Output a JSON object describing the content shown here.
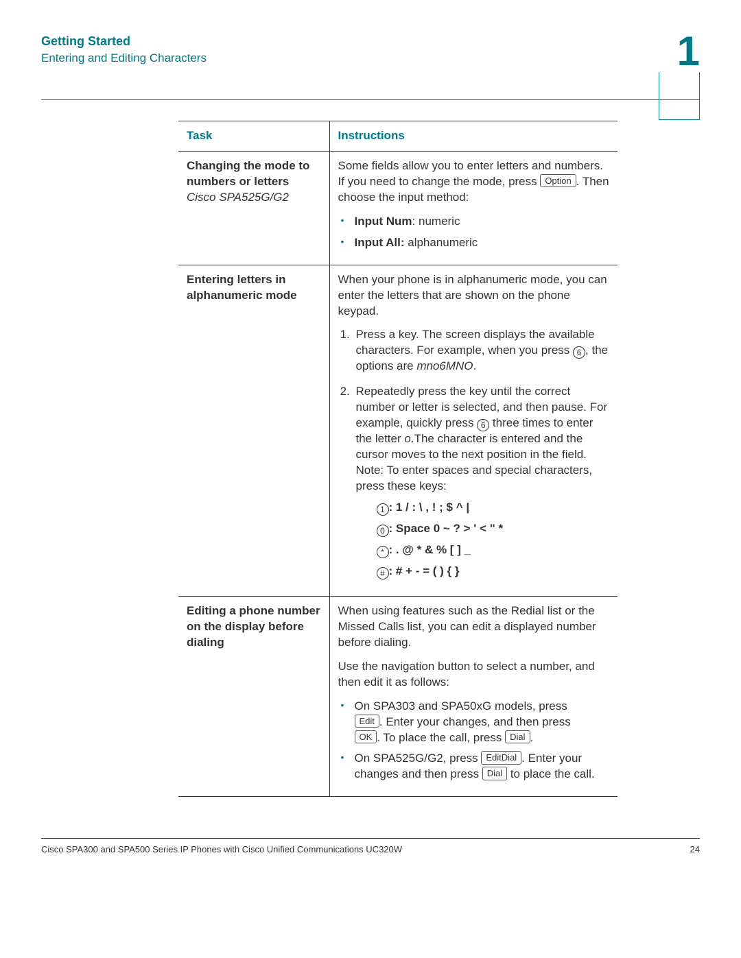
{
  "header": {
    "title": "Getting Started",
    "subtitle": "Entering and Editing Characters",
    "chapter": "1"
  },
  "table": {
    "col_task": "Task",
    "col_instr": "Instructions"
  },
  "row1": {
    "task_l1": "Changing the mode to numbers or letters",
    "task_l2": "Cisco SPA525G/G2",
    "p1a": "Some fields allow you to enter letters and numbers. If you need to change the mode, press ",
    "option": "Option",
    "p1b": ". Then choose the input method:",
    "b1_label": "Input Num",
    "b1_desc": ": numeric",
    "b2_label": "Input All:",
    "b2_desc": " alphanumeric"
  },
  "row2": {
    "task": "Entering letters in alphanumeric mode",
    "p1": "When your phone is in alphanumeric mode, you can enter the letters that are shown on the phone keypad.",
    "step1a": "Press a key. The screen displays the available characters. For example, when you press ",
    "key6a": "6",
    "step1b": ", the options are ",
    "step1c": "mno6MNO",
    "step1d": ".",
    "step2a": "Repeatedly press the key until the correct number or letter is selected, and then pause. For example, quickly press ",
    "key6b": "6",
    "step2b": " three times to enter the letter ",
    "step2c": "o",
    "step2d": ".The character is entered and the cursor moves to the next position in the field. Note: To enter spaces and special characters, press these keys:",
    "k1_key": "1",
    "k1_chars": ":  1   /  :  \\  ,  !  ;  $  ^  |",
    "k0_key": "0",
    "k0_chars": ":  Space  0  ~  ?  >  '  <  \"  *",
    "ks_key": "*",
    "ks_chars": ":  .  @  *  &  %  [  ]  _",
    "kh_key": "#",
    "kh_chars": ":  #  +  -  =  (  )  {  }"
  },
  "row3": {
    "task": "Editing a phone number on the display before dialing",
    "p1": "When using features such as the Redial list or the Missed Calls list, you can edit a displayed number before dialing.",
    "p2": "Use the navigation button to select a number, and then edit it as follows:",
    "b1a": "On SPA303 and SPA50xG models, press ",
    "sk_edit": "Edit",
    "b1b": ". Enter your changes, and then press ",
    "sk_ok": "OK",
    "b1c": ". To place the call, press ",
    "sk_dial1": "Dial",
    "b1d": ".",
    "b2a": "On SPA525G/G2, press ",
    "sk_editdial": "EditDial",
    "b2b": ". Enter your changes and then press ",
    "sk_dial2": "Dial",
    "b2c": " to place the call."
  },
  "footer": {
    "left": "Cisco SPA300 and SPA500 Series IP Phones with Cisco Unified Communications UC320W",
    "right": "24"
  }
}
